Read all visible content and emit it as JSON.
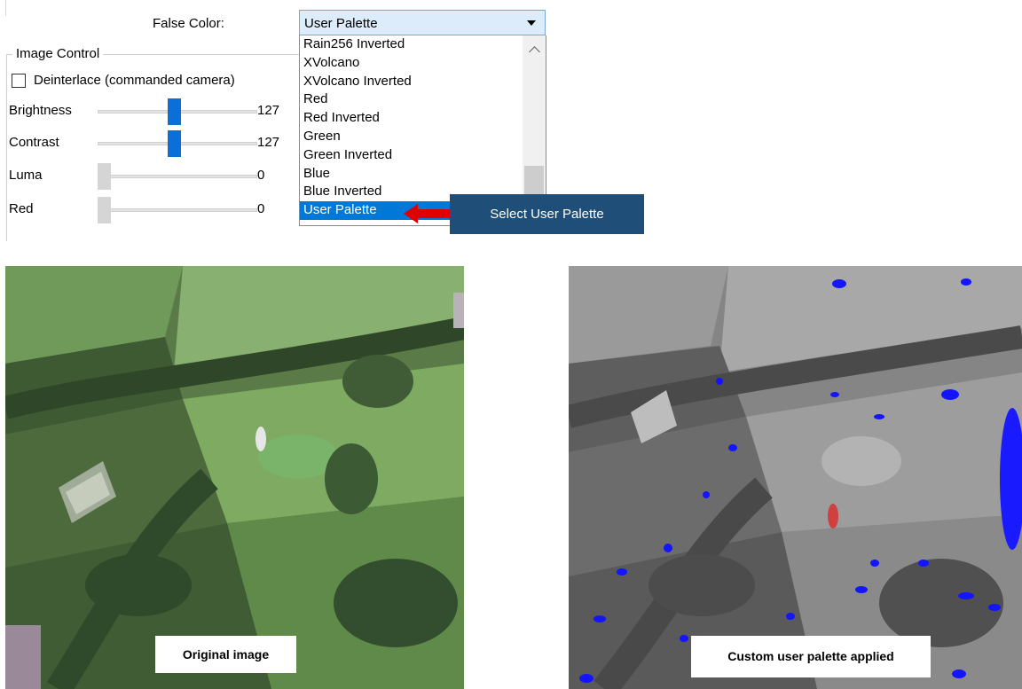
{
  "false_color": {
    "label": "False Color:",
    "selected_value": "User Palette",
    "options": [
      "Rain256 Inverted",
      "XVolcano",
      "XVolcano Inverted",
      "Red",
      "Red Inverted",
      "Green",
      "Green Inverted",
      "Blue",
      "Blue Inverted",
      "User Palette"
    ]
  },
  "image_control": {
    "title": "Image Control",
    "deinterlace_label": "Deinterlace (commanded camera)",
    "deinterlace_checked": false,
    "sliders": [
      {
        "label": "Brightness",
        "value": "127",
        "level": 0.5
      },
      {
        "label": "Contrast",
        "value": "127",
        "level": 0.5
      },
      {
        "label": "Luma",
        "value": "0",
        "level": 0
      },
      {
        "label": "Red",
        "value": "0",
        "level": 0
      }
    ]
  },
  "callout": {
    "text": "Select User Palette",
    "color": "#1f4e79",
    "arrow_color": "#e00000"
  },
  "images": {
    "original_caption": "Original image",
    "custom_caption": "Custom user palette applied"
  },
  "colors": {
    "accent": "#0078d7",
    "slider_thumb": "#0a6fd6"
  }
}
